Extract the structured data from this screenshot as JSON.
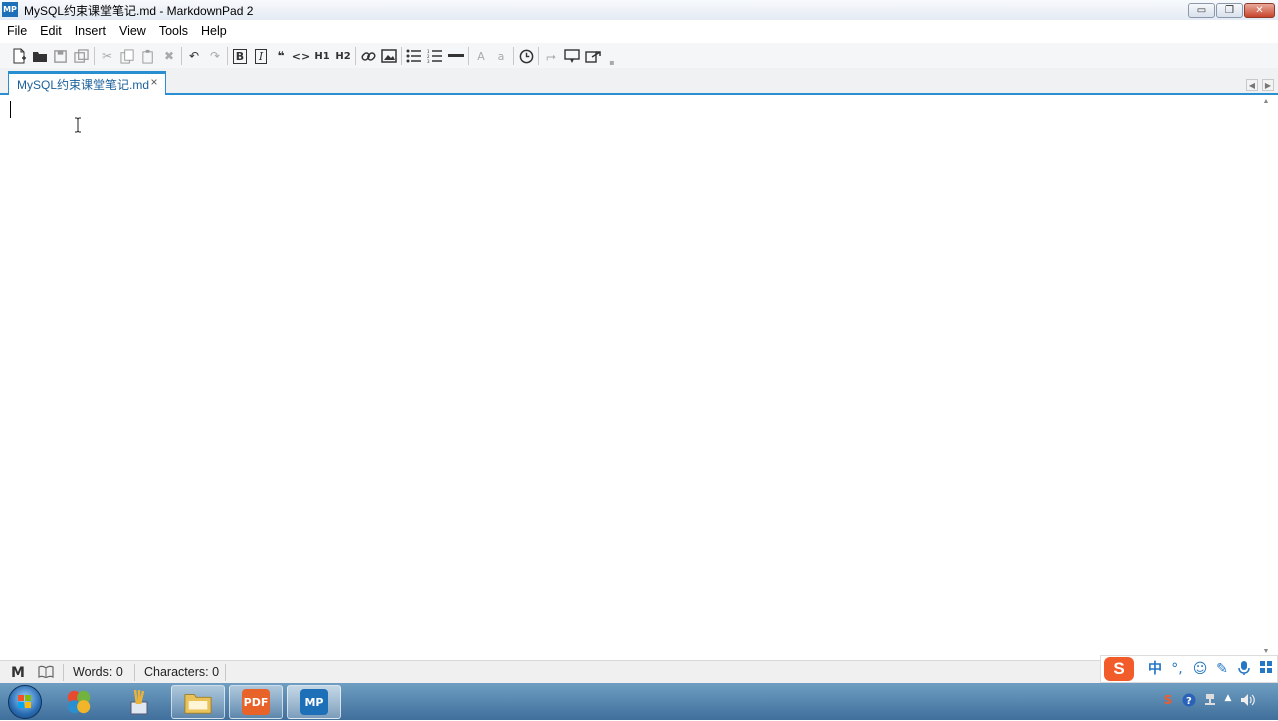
{
  "window": {
    "title": "MySQL约束课堂笔记.md - MarkdownPad 2",
    "app_icon_text": "MP",
    "controls": {
      "minimize": "▭",
      "maximize": "❐",
      "close": "✕"
    }
  },
  "menu": [
    "File",
    "Edit",
    "Insert",
    "View",
    "Tools",
    "Help"
  ],
  "toolbar": {
    "icons": [
      "new-document",
      "open-folder",
      "save",
      "save-all",
      "cut",
      "copy",
      "paste",
      "delete",
      "undo",
      "redo",
      "bold",
      "italic",
      "blockquote",
      "code",
      "heading-1",
      "heading-2",
      "hyperlink",
      "image",
      "unordered-list",
      "ordered-list",
      "horizontal-rule",
      "uppercase",
      "lowercase",
      "timestamp",
      "insert-special",
      "preview",
      "export",
      "overflow"
    ],
    "labels": {
      "h1": "H1",
      "h2": "H2",
      "upper": "A",
      "lower": "a",
      "bold": "B",
      "italic": "I",
      "quote": "❝",
      "code": "<>"
    }
  },
  "tab": {
    "label": "MySQL约束课堂笔记.md",
    "close": "×"
  },
  "editor": {
    "content": ""
  },
  "status": {
    "words": "Words: 0",
    "characters": "Characters: 0"
  },
  "ime": {
    "logo": "S",
    "mode": "中",
    "punct": "°,",
    "emoji": "☺",
    "pen": "✎",
    "mic": "🎤",
    "grid": "▦"
  },
  "taskbar": {
    "apps": [
      {
        "name": "windows-media-center",
        "label": ""
      },
      {
        "name": "paint-tools",
        "label": ""
      },
      {
        "name": "file-explorer",
        "label": ""
      },
      {
        "name": "pdf-reader",
        "label": "PDF"
      },
      {
        "name": "markdownpad",
        "label": "MP"
      }
    ]
  },
  "colors": {
    "accent": "#2a8fd0",
    "taskbar": "#4f81ad",
    "mp_brand": "#1d6fb8",
    "ime_brand": "#f25b2a"
  }
}
